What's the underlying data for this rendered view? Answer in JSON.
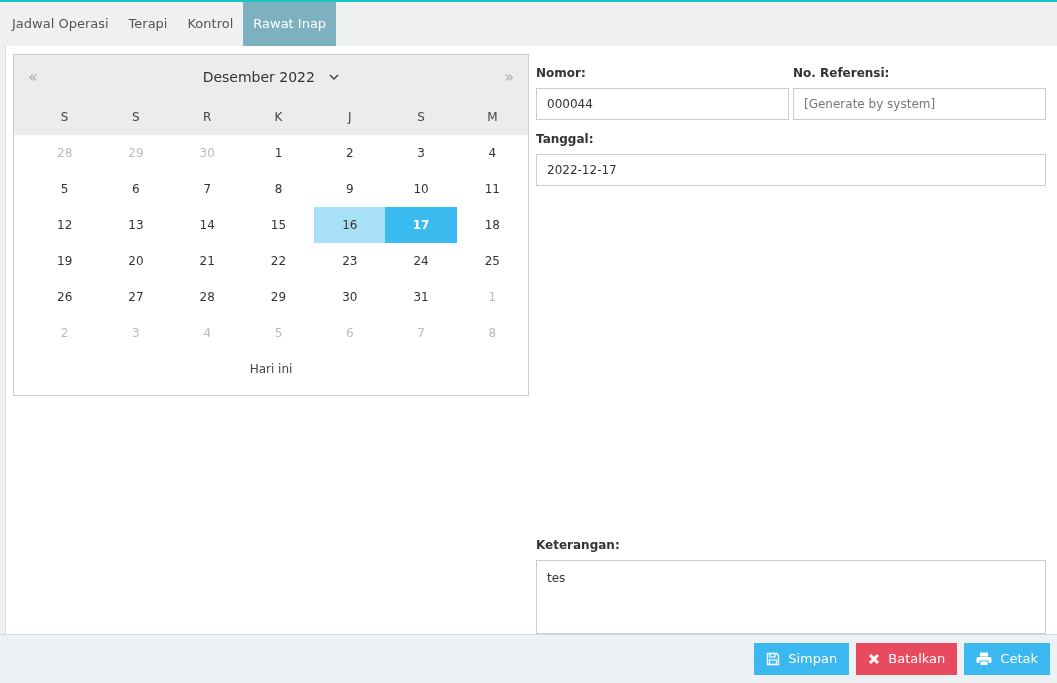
{
  "tabs": [
    {
      "label": "Jadwal Operasi",
      "selected": false
    },
    {
      "label": "Terapi",
      "selected": false
    },
    {
      "label": "Kontrol",
      "selected": false
    },
    {
      "label": "Rawat Inap",
      "selected": true
    }
  ],
  "calendar": {
    "prev": "«",
    "month_label": "Desember 2022",
    "next": "»",
    "weekdays": [
      "S",
      "S",
      "R",
      "K",
      "J",
      "S",
      "M"
    ],
    "weeks": [
      [
        {
          "day": "28",
          "other_month": true,
          "today": false,
          "selected": false
        },
        {
          "day": "29",
          "other_month": true,
          "today": false,
          "selected": false
        },
        {
          "day": "30",
          "other_month": true,
          "today": false,
          "selected": false
        },
        {
          "day": "1",
          "other_month": false,
          "today": false,
          "selected": false
        },
        {
          "day": "2",
          "other_month": false,
          "today": false,
          "selected": false
        },
        {
          "day": "3",
          "other_month": false,
          "today": false,
          "selected": false
        },
        {
          "day": "4",
          "other_month": false,
          "today": false,
          "selected": false
        }
      ],
      [
        {
          "day": "5",
          "other_month": false,
          "today": false,
          "selected": false
        },
        {
          "day": "6",
          "other_month": false,
          "today": false,
          "selected": false
        },
        {
          "day": "7",
          "other_month": false,
          "today": false,
          "selected": false
        },
        {
          "day": "8",
          "other_month": false,
          "today": false,
          "selected": false
        },
        {
          "day": "9",
          "other_month": false,
          "today": false,
          "selected": false
        },
        {
          "day": "10",
          "other_month": false,
          "today": false,
          "selected": false
        },
        {
          "day": "11",
          "other_month": false,
          "today": false,
          "selected": false
        }
      ],
      [
        {
          "day": "12",
          "other_month": false,
          "today": false,
          "selected": false
        },
        {
          "day": "13",
          "other_month": false,
          "today": false,
          "selected": false
        },
        {
          "day": "14",
          "other_month": false,
          "today": false,
          "selected": false
        },
        {
          "day": "15",
          "other_month": false,
          "today": false,
          "selected": false
        },
        {
          "day": "16",
          "other_month": false,
          "today": true,
          "selected": false
        },
        {
          "day": "17",
          "other_month": false,
          "today": false,
          "selected": true
        },
        {
          "day": "18",
          "other_month": false,
          "today": false,
          "selected": false
        }
      ],
      [
        {
          "day": "19",
          "other_month": false,
          "today": false,
          "selected": false
        },
        {
          "day": "20",
          "other_month": false,
          "today": false,
          "selected": false
        },
        {
          "day": "21",
          "other_month": false,
          "today": false,
          "selected": false
        },
        {
          "day": "22",
          "other_month": false,
          "today": false,
          "selected": false
        },
        {
          "day": "23",
          "other_month": false,
          "today": false,
          "selected": false
        },
        {
          "day": "24",
          "other_month": false,
          "today": false,
          "selected": false
        },
        {
          "day": "25",
          "other_month": false,
          "today": false,
          "selected": false
        }
      ],
      [
        {
          "day": "26",
          "other_month": false,
          "today": false,
          "selected": false
        },
        {
          "day": "27",
          "other_month": false,
          "today": false,
          "selected": false
        },
        {
          "day": "28",
          "other_month": false,
          "today": false,
          "selected": false
        },
        {
          "day": "29",
          "other_month": false,
          "today": false,
          "selected": false
        },
        {
          "day": "30",
          "other_month": false,
          "today": false,
          "selected": false
        },
        {
          "day": "31",
          "other_month": false,
          "today": false,
          "selected": false
        },
        {
          "day": "1",
          "other_month": true,
          "today": false,
          "selected": false
        }
      ],
      [
        {
          "day": "2",
          "other_month": true,
          "today": false,
          "selected": false
        },
        {
          "day": "3",
          "other_month": true,
          "today": false,
          "selected": false
        },
        {
          "day": "4",
          "other_month": true,
          "today": false,
          "selected": false
        },
        {
          "day": "5",
          "other_month": true,
          "today": false,
          "selected": false
        },
        {
          "day": "6",
          "other_month": true,
          "today": false,
          "selected": false
        },
        {
          "day": "7",
          "other_month": true,
          "today": false,
          "selected": false
        },
        {
          "day": "8",
          "other_month": true,
          "today": false,
          "selected": false
        }
      ]
    ],
    "today_button": "Hari ini"
  },
  "form": {
    "nomor": {
      "label": "Nomor:",
      "value": "000044"
    },
    "referensi": {
      "label": "No. Referensi:",
      "placeholder": "[Generate by system]"
    },
    "tanggal": {
      "label": "Tanggal:",
      "value": "2022-12-17"
    },
    "keterangan": {
      "label": "Keterangan:",
      "value": "tes"
    }
  },
  "buttons": [
    {
      "kind": "save",
      "label": "Simpan"
    },
    {
      "kind": "cancel",
      "label": "Batalkan"
    },
    {
      "kind": "print",
      "label": "Cetak"
    }
  ]
}
